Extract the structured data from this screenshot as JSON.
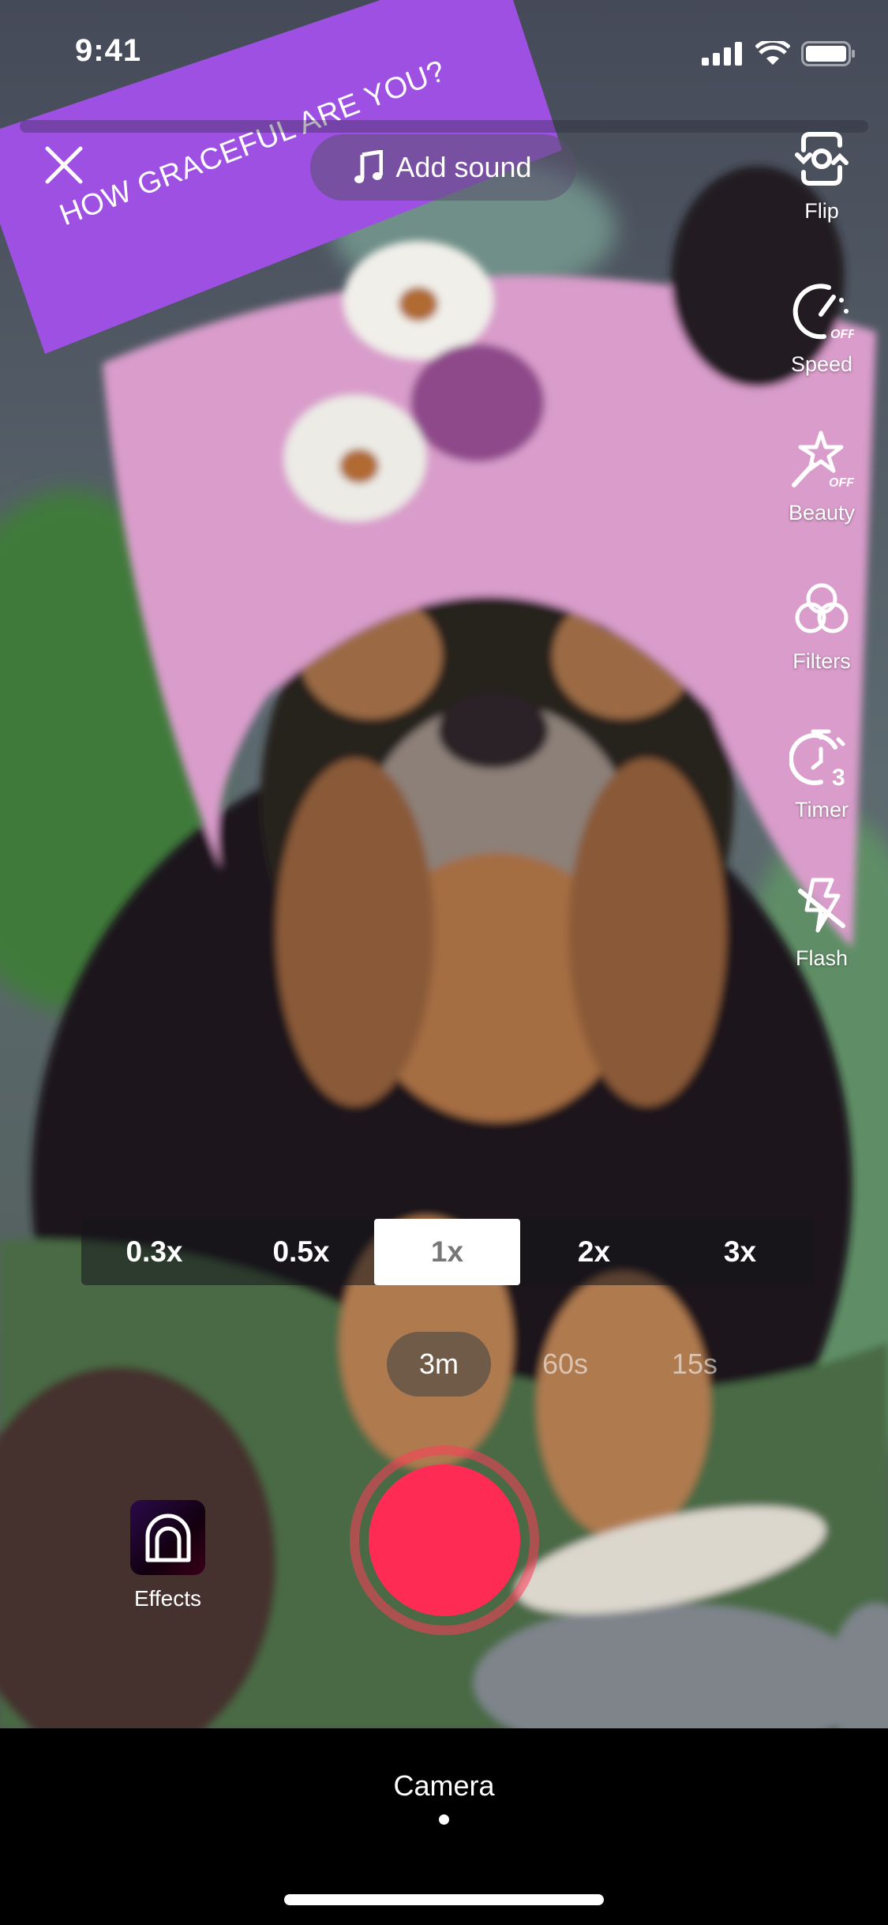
{
  "status_bar": {
    "time": "9:41",
    "icons": [
      "signal-icon",
      "wifi-icon",
      "battery-icon"
    ]
  },
  "recording_progress": 0,
  "banner": {
    "text": "HOW GRACEFUL ARE YOU?",
    "color": "#9E50E3"
  },
  "top": {
    "close_icon": "close-icon",
    "add_sound_label": "Add sound",
    "sound_icon": "music-note-icon"
  },
  "side_tools": [
    {
      "label": "Flip",
      "icon": "flip-camera-icon"
    },
    {
      "label": "Speed",
      "icon": "speed-icon",
      "state": "OFF"
    },
    {
      "label": "Beauty",
      "icon": "beauty-wand-icon",
      "state": "OFF"
    },
    {
      "label": "Filters",
      "icon": "filters-icon"
    },
    {
      "label": "Timer",
      "icon": "timer-icon",
      "state": "3"
    },
    {
      "label": "Flash",
      "icon": "flash-off-icon"
    }
  ],
  "zoom_levels": {
    "options": [
      "0.3x",
      "0.5x",
      "1x",
      "2x",
      "3x"
    ],
    "selected": "1x"
  },
  "durations": {
    "options": [
      "3m",
      "60s",
      "15s"
    ],
    "selected": "3m"
  },
  "effects": {
    "label": "Effects",
    "icon": "effects-arch-icon"
  },
  "record": {
    "color": "#FE2C55"
  },
  "bottom": {
    "mode_label": "Camera"
  }
}
